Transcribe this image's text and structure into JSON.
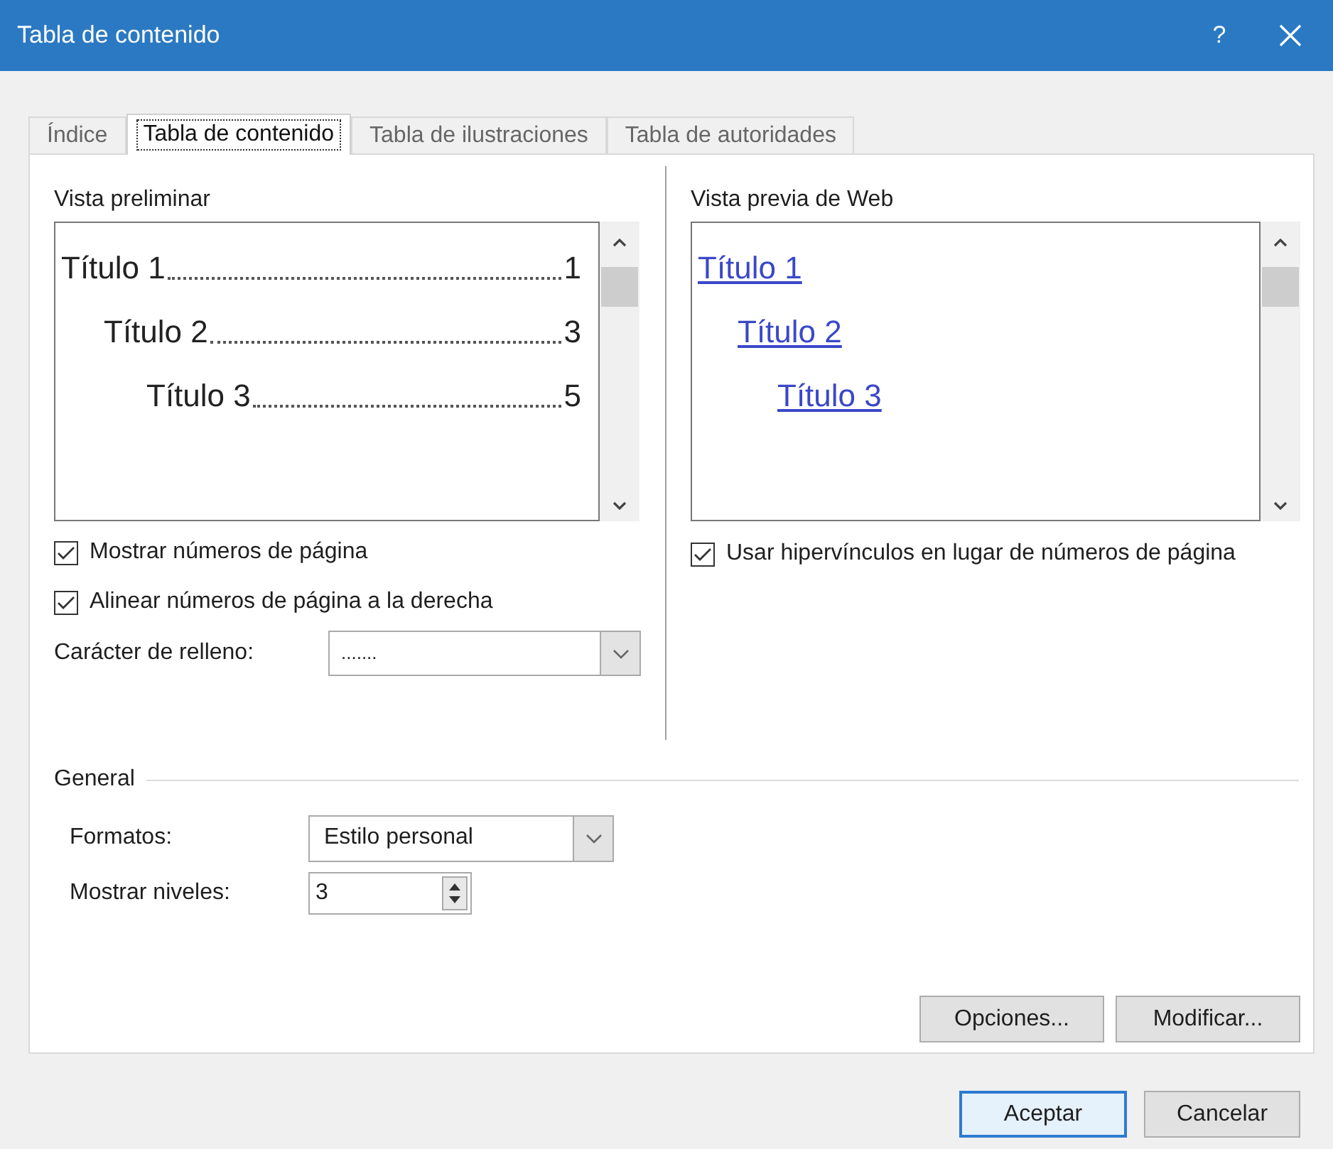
{
  "window": {
    "title": "Tabla de contenido",
    "help": "?"
  },
  "tabs": [
    {
      "label": "Índice",
      "selected": false
    },
    {
      "label": "Tabla de contenido",
      "selected": true
    },
    {
      "label": "Tabla de ilustraciones",
      "selected": false
    },
    {
      "label": "Tabla de autoridades",
      "selected": false
    }
  ],
  "print_preview": {
    "label": "Vista preliminar",
    "entries": [
      {
        "title": "Título 1",
        "page": "1",
        "children": [
          {
            "title": "Título 2",
            "page": "3",
            "children": [
              {
                "title": "Título 3",
                "page": "5"
              }
            ]
          }
        ]
      }
    ]
  },
  "print_options": [
    {
      "label": "Mostrar números de página",
      "checked": true
    },
    {
      "label": "Alinear números de página a la derecha",
      "checked": true
    }
  ],
  "tab_leader": {
    "label": "Carácter de relleno:",
    "value": "......."
  },
  "web_preview": {
    "label": "Vista previa de Web",
    "entries": [
      {
        "title": "Título 1",
        "children": [
          {
            "title": "Título 2",
            "children": [
              {
                "title": "Título 3"
              }
            ]
          }
        ]
      }
    ]
  },
  "web_option": {
    "label": "Usar hipervínculos en lugar de números de página",
    "checked": true
  },
  "general": {
    "label": "General",
    "formats": {
      "label": "Formatos:",
      "value": "Estilo personal"
    },
    "levels": {
      "label": "Mostrar niveles:",
      "value": "3"
    }
  },
  "panel_buttons": [
    "Opciones...",
    "Modificar..."
  ],
  "dialog_buttons": [
    {
      "label": "Aceptar",
      "default": true
    },
    {
      "label": "Cancelar",
      "default": false
    }
  ]
}
